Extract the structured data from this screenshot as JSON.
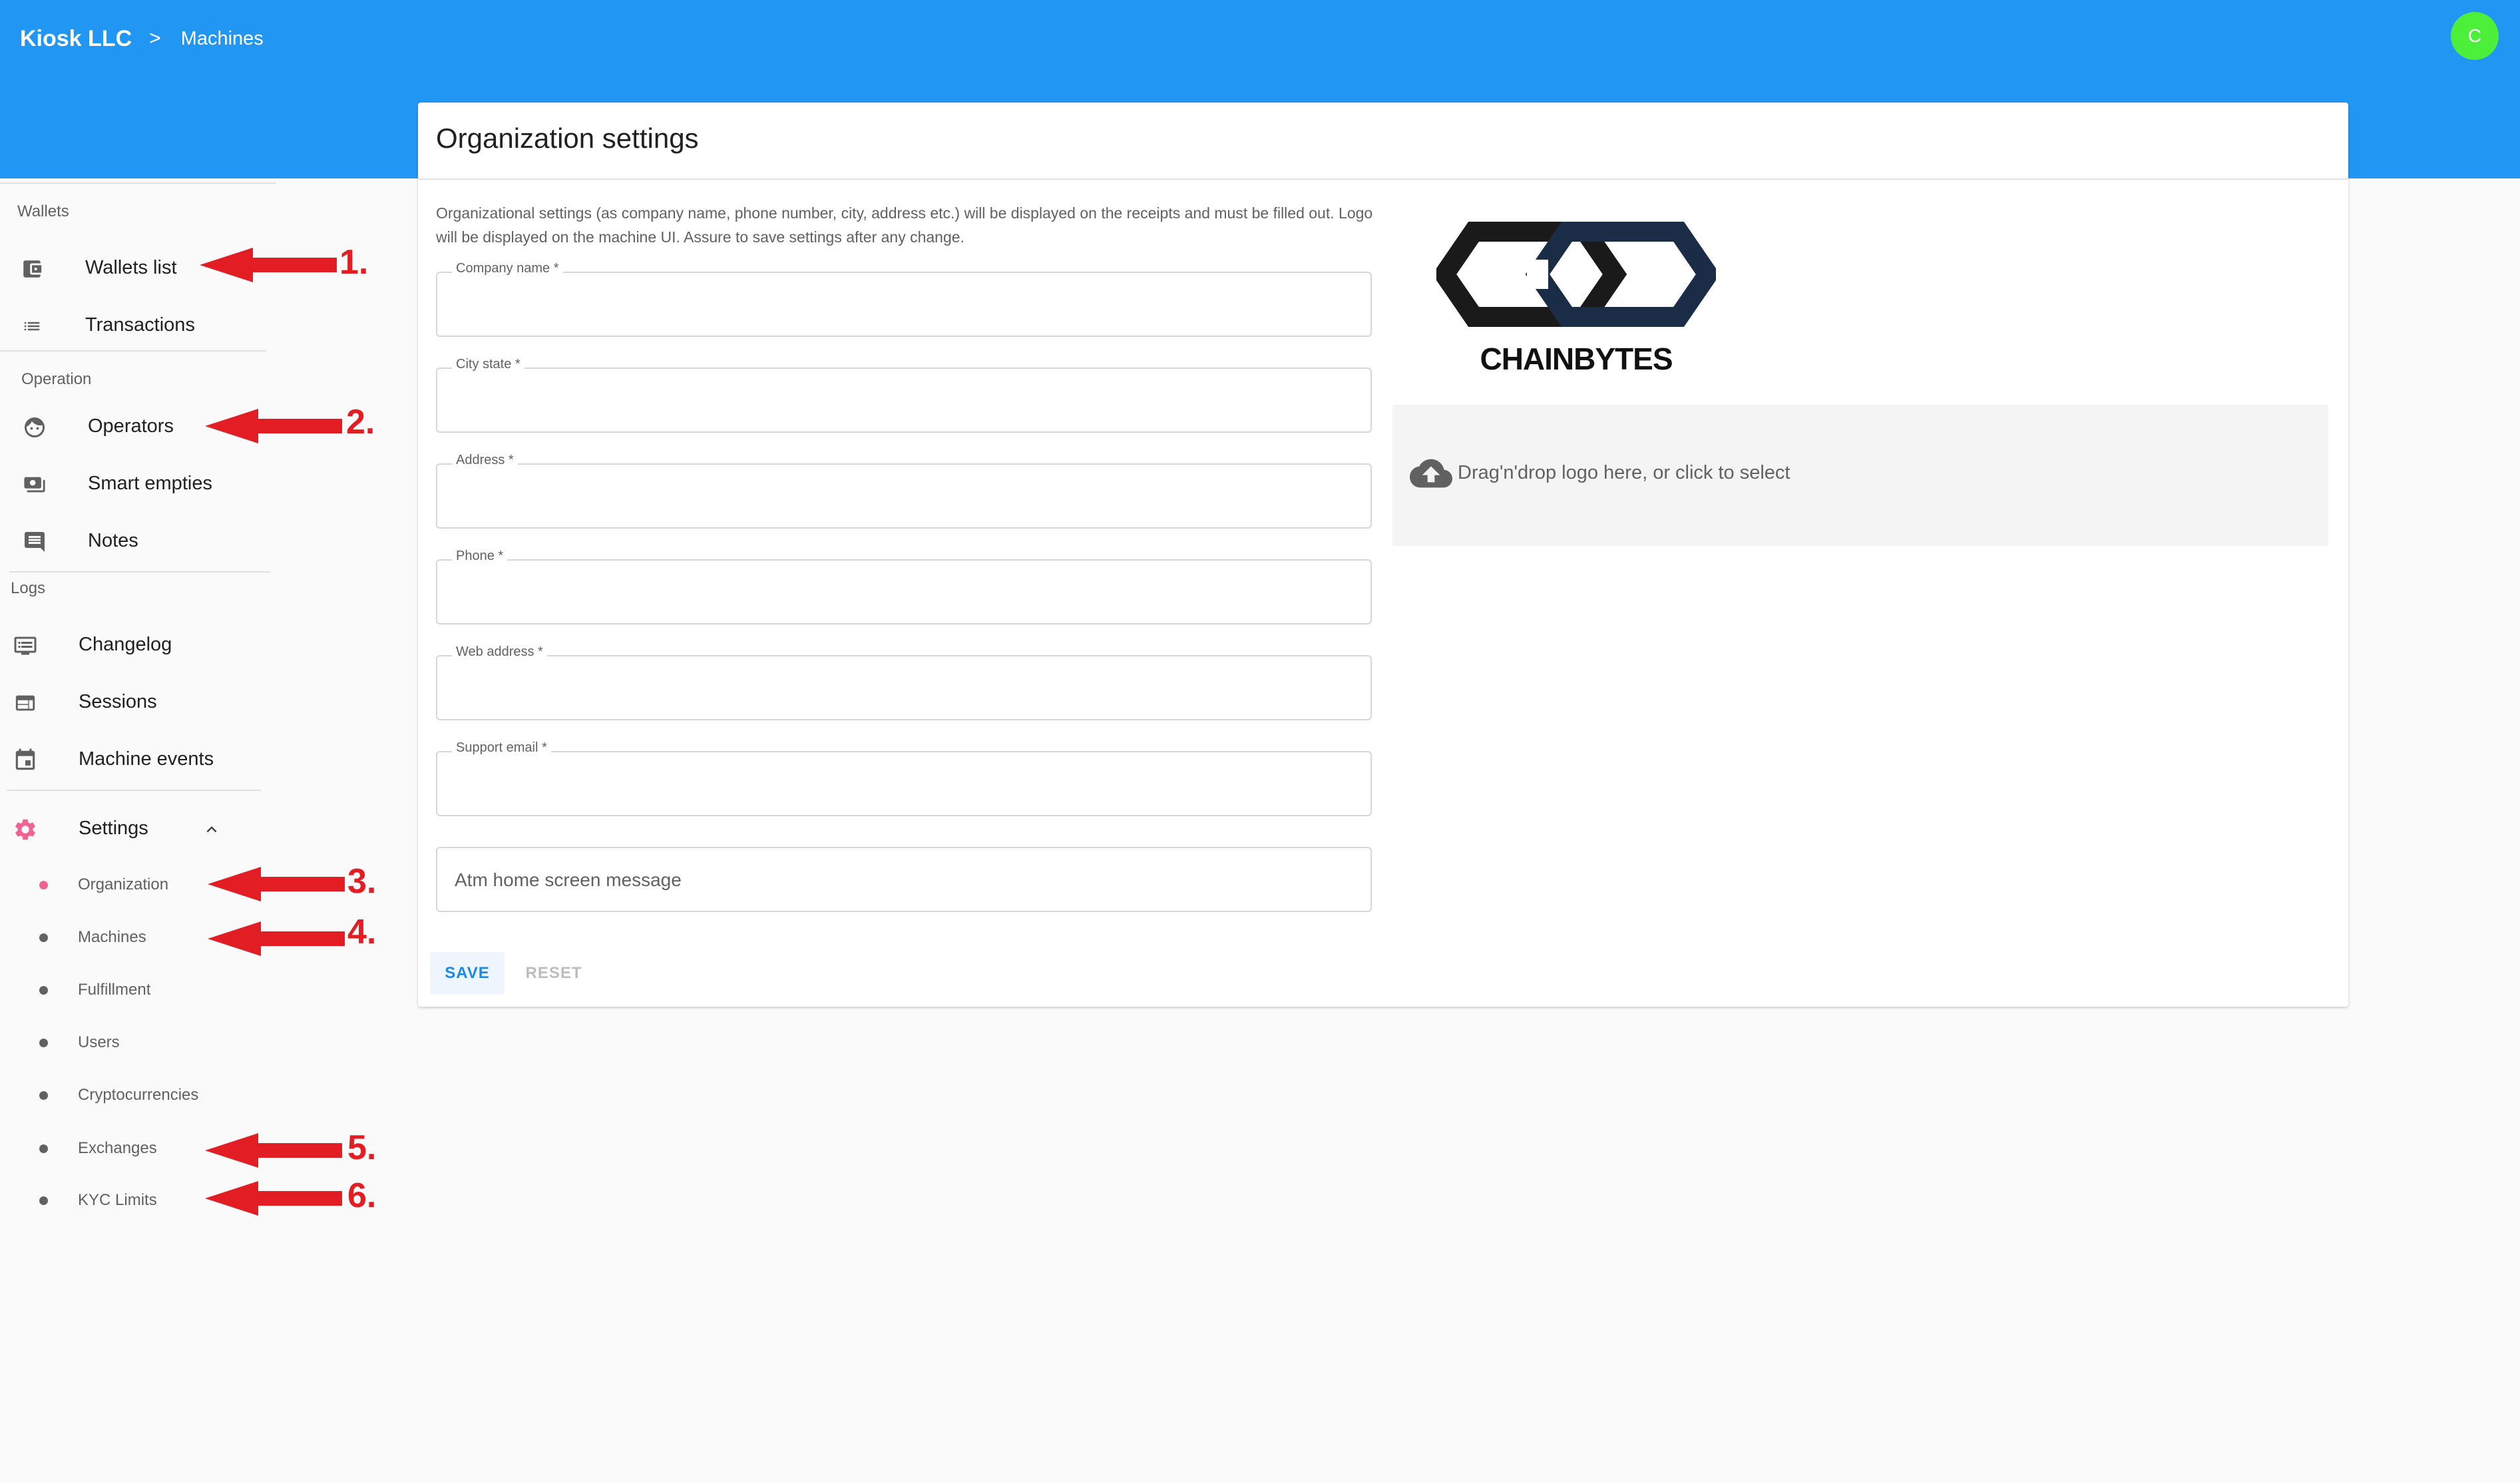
{
  "header": {
    "breadcrumb_home": "Kiosk LLC",
    "breadcrumb_separator": ">",
    "breadcrumb_current": "Machines",
    "avatar_initial": "C",
    "bar_color": "#2196f3",
    "avatar_color": "#4cf03a"
  },
  "sidebar": {
    "sections": [
      {
        "title": "Wallets",
        "items": [
          {
            "label": "Wallets list",
            "icon": "wallet-icon"
          },
          {
            "label": "Transactions",
            "icon": "list-icon"
          }
        ]
      },
      {
        "title": "Operation",
        "items": [
          {
            "label": "Operators",
            "icon": "face-icon"
          },
          {
            "label": "Smart empties",
            "icon": "cash-icon"
          },
          {
            "label": "Notes",
            "icon": "comment-icon"
          }
        ]
      },
      {
        "title": "Logs",
        "items": [
          {
            "label": "Changelog",
            "icon": "monitor-list-icon"
          },
          {
            "label": "Sessions",
            "icon": "browser-window-icon"
          },
          {
            "label": "Machine events",
            "icon": "calendar-icon"
          }
        ]
      }
    ],
    "settings": {
      "label": "Settings",
      "icon": "gear-icon",
      "expand_icon": "chevron-up-icon",
      "accent_color": "#f06292",
      "subitems": [
        "Organization",
        "Machines",
        "Fulfillment",
        "Users",
        "Cryptocurrencies",
        "Exchanges",
        "KYC Limits"
      ],
      "active": "Organization"
    }
  },
  "annotations": [
    "1.",
    "2.",
    "3.",
    "4.",
    "5.",
    "6."
  ],
  "annotation_color": "#e21d24",
  "card": {
    "title": "Organization settings",
    "description": "Organizational settings (as company name, phone number, city, address etc.) will be displayed on the receipts and must be filled out. Logo will be displayed on the machine UI. Assure to save settings after any change.",
    "fields": [
      {
        "label": "Company name *",
        "value": ""
      },
      {
        "label": "City state *",
        "value": ""
      },
      {
        "label": "Address *",
        "value": ""
      },
      {
        "label": "Phone *",
        "value": ""
      },
      {
        "label": "Web address *",
        "value": ""
      },
      {
        "label": "Support email *",
        "value": ""
      }
    ],
    "message_placeholder": "Atm home screen message",
    "save_label": "SAVE",
    "reset_label": "RESET",
    "logo_text": "CHAINBYTES",
    "logo_colors": [
      "#1a1a1a",
      "#1b2c47"
    ],
    "dropzone_text": "Drag'n'drop logo here, or click to select",
    "dropzone_icon": "cloud-upload-icon"
  }
}
